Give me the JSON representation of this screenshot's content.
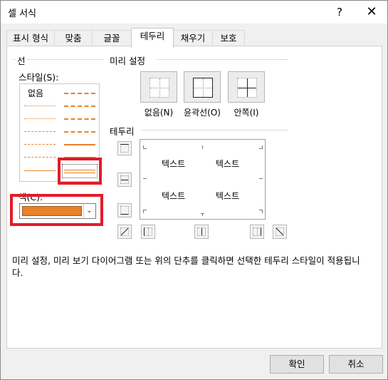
{
  "window": {
    "title": "셀 서식",
    "help": "?",
    "close": "✕"
  },
  "tabs": [
    {
      "label": "표시 형식"
    },
    {
      "label": "맞춤"
    },
    {
      "label": "글꼴"
    },
    {
      "label": "테두리",
      "active": true
    },
    {
      "label": "채우기"
    },
    {
      "label": "보호"
    }
  ],
  "line": {
    "group": "선",
    "style_label": "스타일(S):",
    "none_label": "없음",
    "color_label": "색(C):",
    "color_value": "#e8822b"
  },
  "presets": {
    "group": "미리 설정",
    "items": [
      {
        "label": "없음(N)"
      },
      {
        "label": "윤곽선(O)"
      },
      {
        "label": "안쪽(I)"
      }
    ]
  },
  "border": {
    "group": "테두리",
    "preview_text": [
      "텍스트",
      "텍스트",
      "텍스트",
      "텍스트"
    ]
  },
  "info": "미리 설정, 미리 보기 다이어그램 또는 위의 단추를 클릭하면 선택한 테두리 스타일이 적용됩니다.",
  "buttons": {
    "ok": "확인",
    "cancel": "취소"
  },
  "colors": {
    "highlight": "#e21c2a",
    "line_accent": "#e8822b"
  }
}
